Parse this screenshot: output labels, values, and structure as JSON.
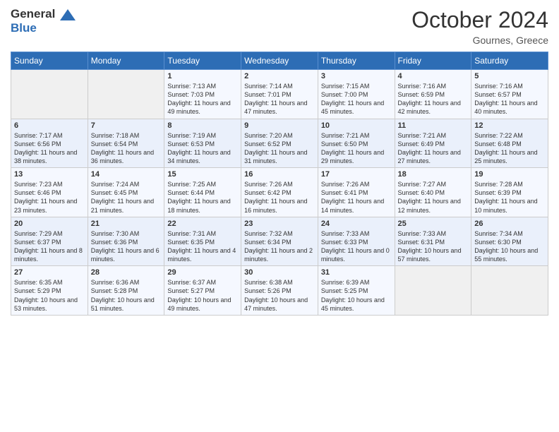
{
  "header": {
    "logo_line1": "General",
    "logo_line2": "Blue",
    "month": "October 2024",
    "location": "Gournes, Greece"
  },
  "weekdays": [
    "Sunday",
    "Monday",
    "Tuesday",
    "Wednesday",
    "Thursday",
    "Friday",
    "Saturday"
  ],
  "weeks": [
    [
      {
        "day": "",
        "empty": true
      },
      {
        "day": "",
        "empty": true
      },
      {
        "day": "1",
        "sunrise": "7:13 AM",
        "sunset": "7:03 PM",
        "daylight": "11 hours and 49 minutes."
      },
      {
        "day": "2",
        "sunrise": "7:14 AM",
        "sunset": "7:01 PM",
        "daylight": "11 hours and 47 minutes."
      },
      {
        "day": "3",
        "sunrise": "7:15 AM",
        "sunset": "7:00 PM",
        "daylight": "11 hours and 45 minutes."
      },
      {
        "day": "4",
        "sunrise": "7:16 AM",
        "sunset": "6:59 PM",
        "daylight": "11 hours and 42 minutes."
      },
      {
        "day": "5",
        "sunrise": "7:16 AM",
        "sunset": "6:57 PM",
        "daylight": "11 hours and 40 minutes."
      }
    ],
    [
      {
        "day": "6",
        "sunrise": "7:17 AM",
        "sunset": "6:56 PM",
        "daylight": "11 hours and 38 minutes."
      },
      {
        "day": "7",
        "sunrise": "7:18 AM",
        "sunset": "6:54 PM",
        "daylight": "11 hours and 36 minutes."
      },
      {
        "day": "8",
        "sunrise": "7:19 AM",
        "sunset": "6:53 PM",
        "daylight": "11 hours and 34 minutes."
      },
      {
        "day": "9",
        "sunrise": "7:20 AM",
        "sunset": "6:52 PM",
        "daylight": "11 hours and 31 minutes."
      },
      {
        "day": "10",
        "sunrise": "7:21 AM",
        "sunset": "6:50 PM",
        "daylight": "11 hours and 29 minutes."
      },
      {
        "day": "11",
        "sunrise": "7:21 AM",
        "sunset": "6:49 PM",
        "daylight": "11 hours and 27 minutes."
      },
      {
        "day": "12",
        "sunrise": "7:22 AM",
        "sunset": "6:48 PM",
        "daylight": "11 hours and 25 minutes."
      }
    ],
    [
      {
        "day": "13",
        "sunrise": "7:23 AM",
        "sunset": "6:46 PM",
        "daylight": "11 hours and 23 minutes."
      },
      {
        "day": "14",
        "sunrise": "7:24 AM",
        "sunset": "6:45 PM",
        "daylight": "11 hours and 21 minutes."
      },
      {
        "day": "15",
        "sunrise": "7:25 AM",
        "sunset": "6:44 PM",
        "daylight": "11 hours and 18 minutes."
      },
      {
        "day": "16",
        "sunrise": "7:26 AM",
        "sunset": "6:42 PM",
        "daylight": "11 hours and 16 minutes."
      },
      {
        "day": "17",
        "sunrise": "7:26 AM",
        "sunset": "6:41 PM",
        "daylight": "11 hours and 14 minutes."
      },
      {
        "day": "18",
        "sunrise": "7:27 AM",
        "sunset": "6:40 PM",
        "daylight": "11 hours and 12 minutes."
      },
      {
        "day": "19",
        "sunrise": "7:28 AM",
        "sunset": "6:39 PM",
        "daylight": "11 hours and 10 minutes."
      }
    ],
    [
      {
        "day": "20",
        "sunrise": "7:29 AM",
        "sunset": "6:37 PM",
        "daylight": "11 hours and 8 minutes."
      },
      {
        "day": "21",
        "sunrise": "7:30 AM",
        "sunset": "6:36 PM",
        "daylight": "11 hours and 6 minutes."
      },
      {
        "day": "22",
        "sunrise": "7:31 AM",
        "sunset": "6:35 PM",
        "daylight": "11 hours and 4 minutes."
      },
      {
        "day": "23",
        "sunrise": "7:32 AM",
        "sunset": "6:34 PM",
        "daylight": "11 hours and 2 minutes."
      },
      {
        "day": "24",
        "sunrise": "7:33 AM",
        "sunset": "6:33 PM",
        "daylight": "11 hours and 0 minutes."
      },
      {
        "day": "25",
        "sunrise": "7:33 AM",
        "sunset": "6:31 PM",
        "daylight": "10 hours and 57 minutes."
      },
      {
        "day": "26",
        "sunrise": "7:34 AM",
        "sunset": "6:30 PM",
        "daylight": "10 hours and 55 minutes."
      }
    ],
    [
      {
        "day": "27",
        "sunrise": "6:35 AM",
        "sunset": "5:29 PM",
        "daylight": "10 hours and 53 minutes."
      },
      {
        "day": "28",
        "sunrise": "6:36 AM",
        "sunset": "5:28 PM",
        "daylight": "10 hours and 51 minutes."
      },
      {
        "day": "29",
        "sunrise": "6:37 AM",
        "sunset": "5:27 PM",
        "daylight": "10 hours and 49 minutes."
      },
      {
        "day": "30",
        "sunrise": "6:38 AM",
        "sunset": "5:26 PM",
        "daylight": "10 hours and 47 minutes."
      },
      {
        "day": "31",
        "sunrise": "6:39 AM",
        "sunset": "5:25 PM",
        "daylight": "10 hours and 45 minutes."
      },
      {
        "day": "",
        "empty": true
      },
      {
        "day": "",
        "empty": true
      }
    ]
  ]
}
